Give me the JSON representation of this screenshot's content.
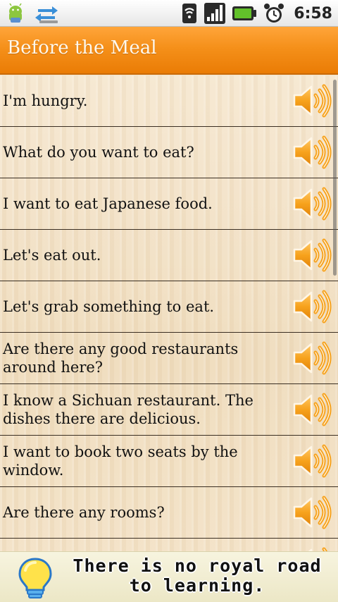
{
  "status_bar": {
    "left_icons": [
      "android-notification-icon",
      "usb-sync-icon"
    ],
    "right_icons": [
      "wifi-icon",
      "signal-icon",
      "battery-icon",
      "alarm-icon"
    ],
    "time": "6:58"
  },
  "header": {
    "title": "Before the Meal",
    "accent_color": "#f5901a"
  },
  "phrases": [
    {
      "text": "I'm hungry.",
      "icon": "speaker-icon"
    },
    {
      "text": "What do you want to eat?",
      "icon": "speaker-icon"
    },
    {
      "text": "I want to eat Japanese food.",
      "icon": "speaker-icon"
    },
    {
      "text": "Let's eat out.",
      "icon": "speaker-icon"
    },
    {
      "text": "Let's grab something to eat.",
      "icon": "speaker-icon"
    },
    {
      "text": "Are there any good restaurants around here?",
      "icon": "speaker-icon"
    },
    {
      "text": "I know a Sichuan restaurant. The dishes there are delicious.",
      "icon": "speaker-icon"
    },
    {
      "text": "I want to book two seats by the window.",
      "icon": "speaker-icon"
    },
    {
      "text": "Are there any rooms?",
      "icon": "speaker-icon"
    },
    {
      "text": "",
      "icon": "speaker-icon"
    }
  ],
  "banner": {
    "icon": "lightbulb-icon",
    "line1": "There is no royal road",
    "line2": "to learning."
  }
}
